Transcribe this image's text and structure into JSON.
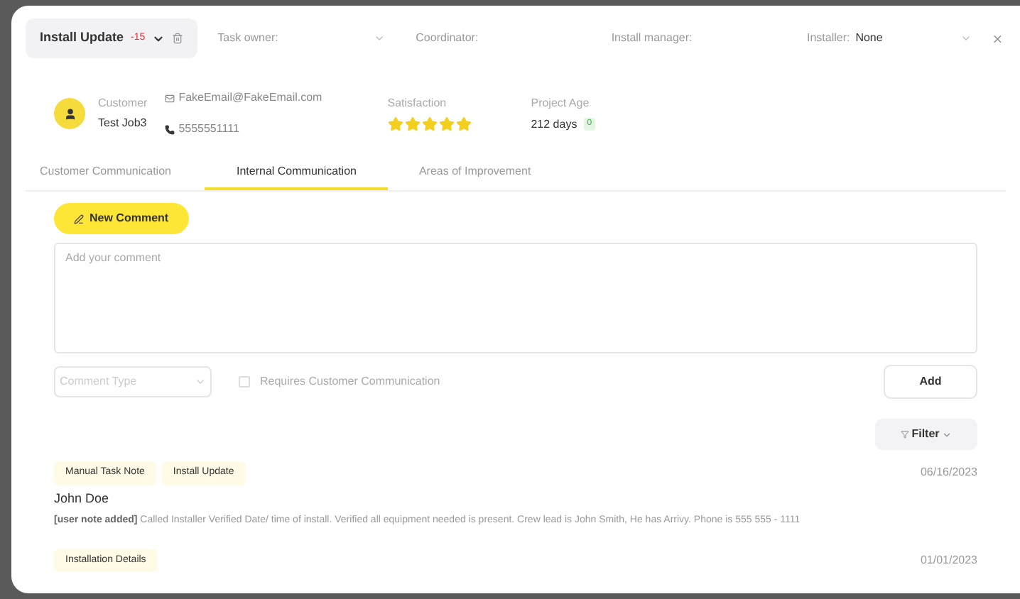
{
  "header": {
    "task": "Install Update",
    "overdue": "-15",
    "fields": [
      {
        "label": "Task owner:"
      },
      {
        "label": "Coordinator:"
      },
      {
        "label": "Install manager:"
      },
      {
        "label": "Installer:",
        "value": "None"
      }
    ]
  },
  "customer": {
    "label": "Customer",
    "name": "Test Job3",
    "email": "FakeEmail@FakeEmail.com",
    "phone": "5555551111"
  },
  "satisfaction": {
    "label": "Satisfaction",
    "stars": 5
  },
  "project_age": {
    "label": "Project Age",
    "value": "212 days",
    "badge": "0"
  },
  "tabs": [
    {
      "label": "Customer Communication",
      "selected": false
    },
    {
      "label": "Internal Communication",
      "selected": true
    },
    {
      "label": "Areas of Improvement",
      "selected": false
    }
  ],
  "new_comment": "New Comment",
  "comment": {
    "placeholder": "Add your comment"
  },
  "comment_type": {
    "placeholder": "Comment Type"
  },
  "requires_customer": {
    "label": "Requires Customer Communication",
    "checked": false
  },
  "add": "Add",
  "filter": "Filter",
  "comments": [
    {
      "tags": [
        "Manual Task Note",
        "Install Update"
      ],
      "date": "06/16/2023",
      "author": "John Doe",
      "text": "**[user note added]** Called Installer Verified Date/ time of install. Verified all equipment needed is present. Crew lead is John Smith, He has Arrivy. Phone is 555 555 - 1111"
    },
    {
      "tags": [
        "Installation Details"
      ],
      "date": "01/01/2023"
    }
  ]
}
